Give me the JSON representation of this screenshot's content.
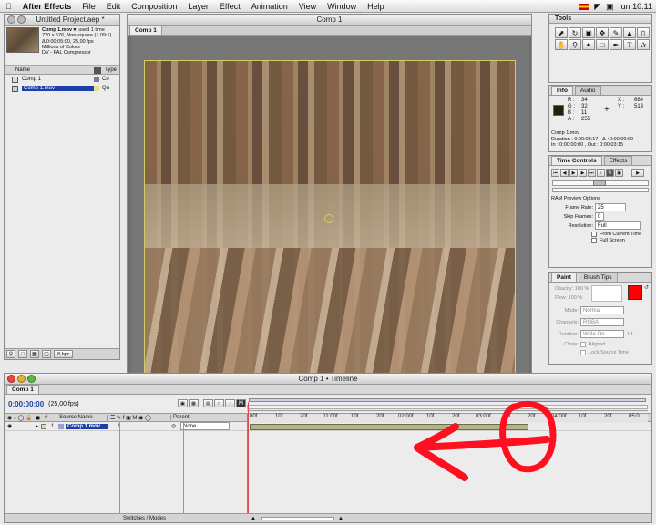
{
  "menubar": {
    "app": "After Effects",
    "items": [
      "File",
      "Edit",
      "Composition",
      "Layer",
      "Effect",
      "Animation",
      "View",
      "Window",
      "Help"
    ],
    "clock": "lun 10:11"
  },
  "project": {
    "title": "Untitled Project.aep *",
    "thumb_name": "Comp 1.mov ▾",
    "thumb_used": ", used 1 time",
    "info_lines": [
      "720 x 576, Non-square (1.09:1)",
      "Δ 0:00:05:00, 25,00 fps",
      "Millions of Colors",
      "DV - PAL Compressor"
    ],
    "col_name": "Name",
    "col_type": "Type",
    "items": [
      {
        "name": "Comp 1",
        "type": "Co"
      },
      {
        "name": "Comp 1.mov",
        "type": "Qu"
      }
    ],
    "bpc": "8 bpc"
  },
  "comp": {
    "title": "Comp 1",
    "tab": "Comp 1"
  },
  "tools": {
    "title": "Tools"
  },
  "info": {
    "tabs": [
      "Info",
      "Audio"
    ],
    "r": "R :",
    "r_val": "34",
    "g": "G :",
    "g_val": "32",
    "b": "B :",
    "b_val": "11",
    "a": "A :",
    "a_val": "255",
    "x": "X :",
    "x_val": "684",
    "y": "Y :",
    "y_val": "513",
    "name": "Comp 1.mov",
    "duration": "Duration : 0:00:03:17 , Δ +0:00:00:09",
    "inout": "In : 0:00:00:00 , Out : 0:00:03:15"
  },
  "time_controls": {
    "tabs": [
      "Time Controls",
      "Effects"
    ],
    "ram_label": "RAM Preview Options",
    "frame_rate_label": "Frame Rate:",
    "frame_rate": "25",
    "skip_label": "Skip Frames:",
    "skip": "0",
    "resolution_label": "Resolution:",
    "resolution": "Full",
    "from_current": "From Current Time",
    "full_screen": "Full Screen"
  },
  "paint": {
    "tabs": [
      "Paint",
      "Brush Tips"
    ],
    "opacity": "Opacity: 100 %",
    "flow": "Flow: 100 %",
    "mode_label": "Mode:",
    "mode": "Normal",
    "channels_label": "Channels:",
    "channels": "RGBA",
    "duration_label": "Duration:",
    "duration": "Write On",
    "duration_extra": "1 f",
    "clone_label": "Clone:",
    "aligned": "Aligned",
    "lock_source": "Lock Source Time",
    "color": "#ff0000"
  },
  "timeline": {
    "title": "Comp 1 • Timeline",
    "tab": "Comp 1",
    "timecode": "0:00:00:00",
    "fps": "(25,00 fps)",
    "col_hash": "#",
    "col_source": "Source Name",
    "col_parent": "Parent",
    "layer_num": "1",
    "layer_name": "Comp 1.mov",
    "parent_value": "None",
    "switches_modes": "Switches / Modes",
    "ruler": [
      "00f",
      "10f",
      "20f",
      "01:00f",
      "10f",
      "20f",
      "02:00f",
      "10f",
      "20f",
      "03:00f",
      "10f",
      "20f",
      "04:00f",
      "10f",
      "20f",
      "05:0"
    ]
  },
  "colors": {
    "accent": "#1c3fa8",
    "layer_bar": "#b3b589",
    "annotation": "#ff1020",
    "timecode": "#1c3fa8"
  }
}
